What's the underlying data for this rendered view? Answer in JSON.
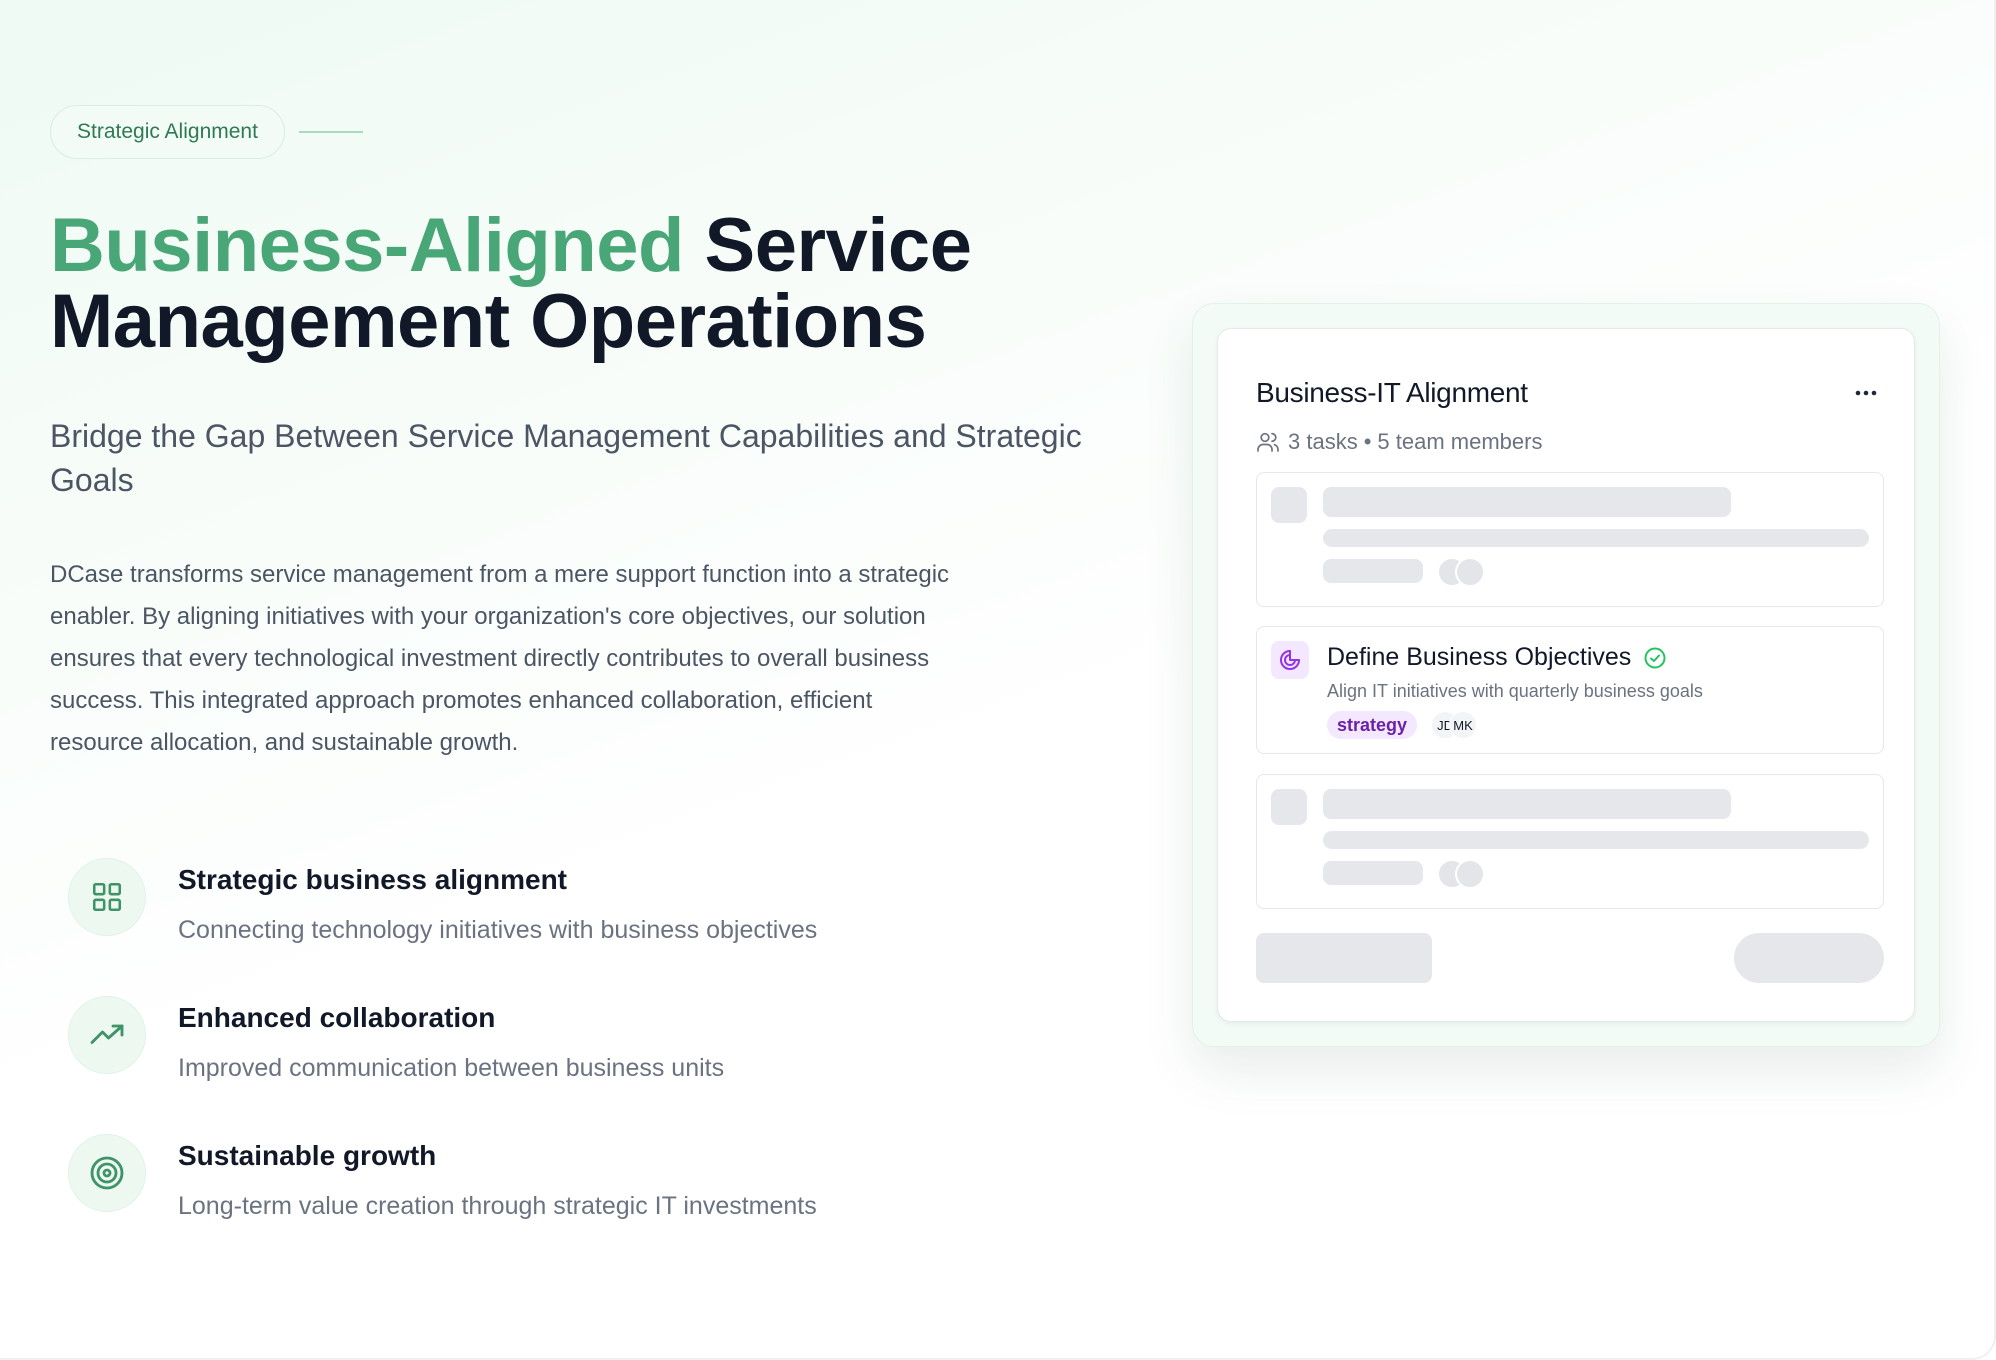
{
  "eyebrow": {
    "label": "Strategic Alignment"
  },
  "hero": {
    "title_accent": "Business-Aligned",
    "title_rest_1": "Service",
    "title_rest_2": "Management Operations",
    "subtitle": "Bridge the Gap Between Service Management Capabilities and Strategic Goals",
    "body": "DCase transforms service management from a mere support function into a strategic enabler. By aligning initiatives with your organization's core objectives, our solution ensures that every technological investment directly contributes to overall business success. This integrated approach promotes enhanced collaboration, efficient resource allocation, and sustainable growth."
  },
  "features": [
    {
      "icon": "grid-icon",
      "title": "Strategic business alignment",
      "desc": "Connecting technology initiatives with business objectives"
    },
    {
      "icon": "trending-up-icon",
      "title": "Enhanced collaboration",
      "desc": "Improved communication between business units"
    },
    {
      "icon": "target-icon",
      "title": "Sustainable growth",
      "desc": "Long-term value creation through strategic IT investments"
    }
  ],
  "card": {
    "title": "Business-IT Alignment",
    "more_icon": "more-horizontal-icon",
    "tasks_count": "3 tasks",
    "separator": "•",
    "members_count": "5 team members",
    "active_task": {
      "title": "Define Business Objectives",
      "desc": "Align IT initiatives with quarterly business goals",
      "tag": "strategy",
      "avatars": [
        "JD",
        "MK"
      ]
    }
  },
  "colors": {
    "accent_green": "#48a677",
    "eyebrow_text": "#2f7a53",
    "tag_purple": "#6b21a8",
    "tag_bg": "#f3e8ff",
    "check_green": "#22c55e"
  }
}
